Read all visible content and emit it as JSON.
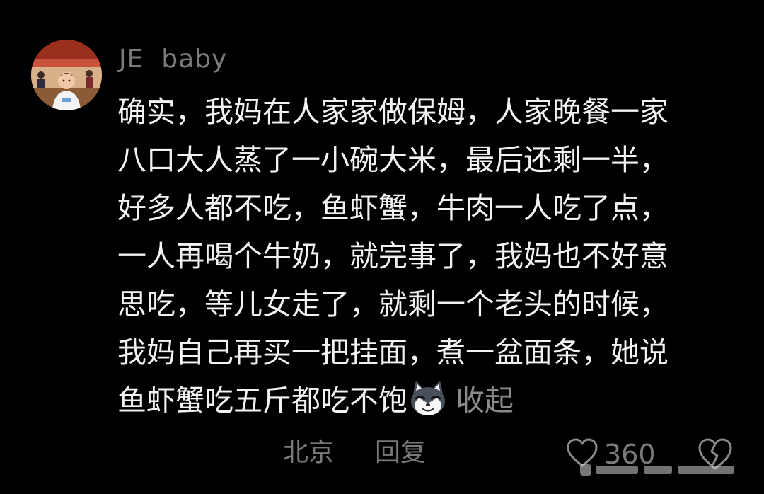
{
  "comment": {
    "username": "JE  baby",
    "text_lines": [
      "确实，我妈在人家家做保姆，人家晚餐一家",
      "八口大人蒸了一小碗大米，最后还剩一半，",
      "好多人都不吃，鱼虾蟹，牛肉一人吃了点，",
      "一人再喝个牛奶，就完事了，我妈也不好意",
      "思吃，等儿女走了，就剩一个老头的时候，",
      "我妈自己再买一把挂面，煮一盆面条，她说",
      "鱼虾蟹吃五斤都吃不饱"
    ],
    "emoji": "cat-face-emoji",
    "collapse_label": "收起",
    "location": "北京",
    "reply_label": "回复",
    "like_count": "360"
  },
  "icons": {
    "avatar": "child-photo-avatar",
    "like": "heart-icon",
    "dislike": "broken-heart-icon"
  },
  "colors": {
    "background": "#000000",
    "text": "#f2f2f2",
    "muted": "#7a7a7a"
  }
}
